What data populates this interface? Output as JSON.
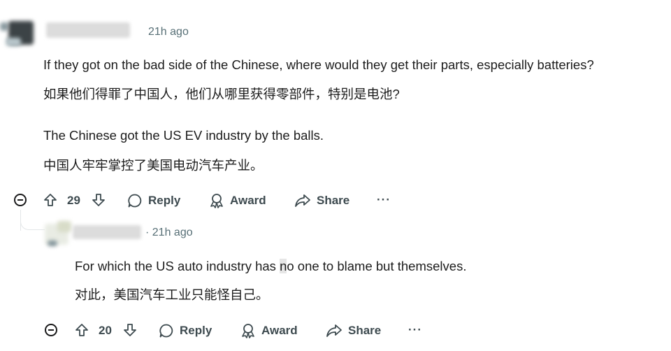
{
  "comment1": {
    "time": "21h ago",
    "lines": [
      "If they got on the bad side of the Chinese, where would they get their parts, especially batteries?",
      "如果他们得罪了中国人，他们从哪里获得零部件，特别是电池?",
      "The Chinese got the US EV industry by the balls.",
      "中国人牢牢掌控了美国电动汽车产业。"
    ],
    "votes": "29",
    "reply_label": "Reply",
    "award_label": "Award",
    "share_label": "Share",
    "more_label": "···"
  },
  "comment2": {
    "time": "· 21h ago",
    "line1_before": "For which the US auto industry has ",
    "line1_hl": "n",
    "line1_after": "o one to blame but themselves.",
    "line2": "对此，美国汽车工业只能怪自己。",
    "votes": "20",
    "reply_label": "Reply",
    "award_label": "Award",
    "share_label": "Share",
    "more_label": "···"
  }
}
